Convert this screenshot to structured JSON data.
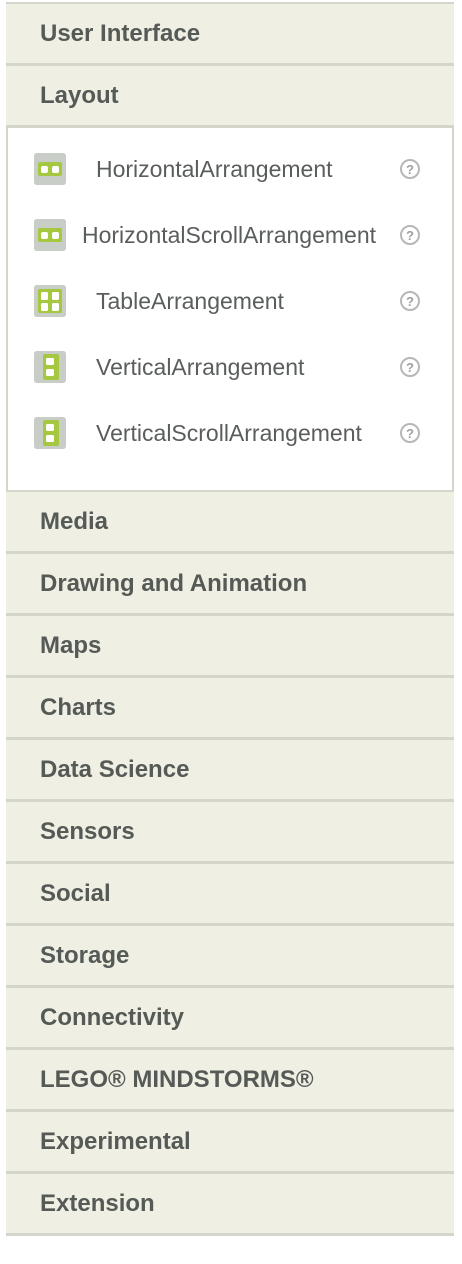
{
  "categories": {
    "user_interface": "User Interface",
    "layout": "Layout",
    "media": "Media",
    "drawing": "Drawing and Animation",
    "maps": "Maps",
    "charts": "Charts",
    "data_science": "Data Science",
    "sensors": "Sensors",
    "social": "Social",
    "storage": "Storage",
    "connectivity": "Connectivity",
    "lego": "LEGO® MINDSTORMS®",
    "experimental": "Experimental",
    "extension": "Extension"
  },
  "layout_components": [
    {
      "label": "HorizontalArrangement",
      "icon": "horizontal-arrangement-icon"
    },
    {
      "label": "HorizontalScrollArrangement",
      "icon": "horizontal-scroll-arrangement-icon"
    },
    {
      "label": "TableArrangement",
      "icon": "table-arrangement-icon"
    },
    {
      "label": "VerticalArrangement",
      "icon": "vertical-arrangement-icon"
    },
    {
      "label": "VerticalScrollArrangement",
      "icon": "vertical-scroll-arrangement-icon"
    }
  ],
  "help_glyph": "?",
  "colors": {
    "header_bg": "#efefe3",
    "icon_green": "#a6c840",
    "header_text": "#555a57"
  }
}
